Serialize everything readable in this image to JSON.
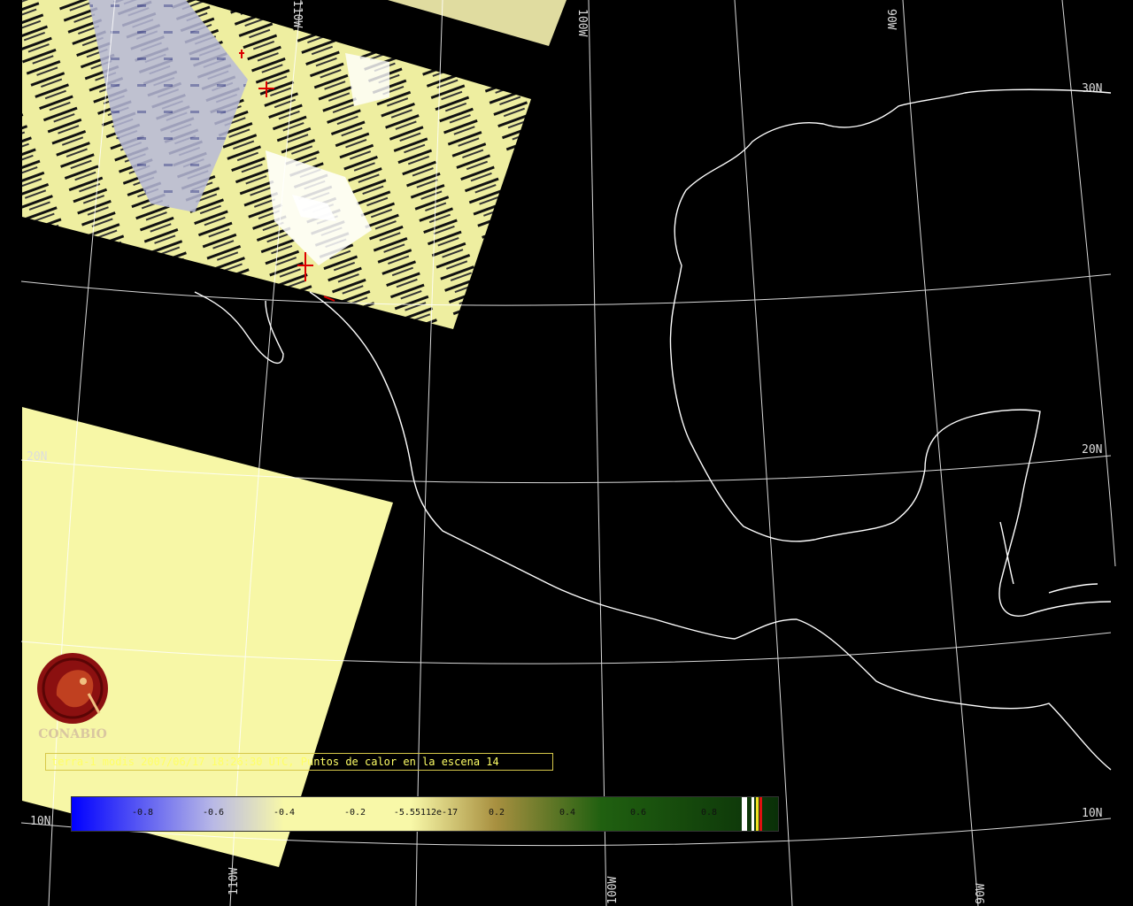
{
  "caption": "terra-1 modis 2007/06/17 18:26:30 UTC, Puntos de calor en la escena 14",
  "logo_text": "CONABIO",
  "grid_labels": {
    "top_110w": "110W",
    "top_100w": "100W",
    "top_90w": "90W",
    "bottom_110w": "110W",
    "bottom_100w": "100W",
    "bottom_90w": "90W",
    "right_30n": "30N",
    "right_20n": "20N",
    "right_10n": "10N",
    "left_20n": "20N",
    "left_10n": "10N"
  },
  "colorbar": {
    "ticks": [
      {
        "label": "-0.8",
        "value": -0.8
      },
      {
        "label": "-0.6",
        "value": -0.6
      },
      {
        "label": "-0.4",
        "value": -0.4
      },
      {
        "label": "-0.2",
        "value": -0.2
      },
      {
        "label": "-5.55112e-17",
        "value": 0.0
      },
      {
        "label": "0.2",
        "value": 0.2
      },
      {
        "label": "0.4",
        "value": 0.4
      },
      {
        "label": "0.6",
        "value": 0.6
      },
      {
        "label": "0.8",
        "value": 0.8
      }
    ],
    "min": -1.0,
    "max": 1.0,
    "colors": {
      "low": "#0000ff",
      "mid_low": "#b8b8e6",
      "mid": "#f8f8a8",
      "mid_high": "#a89040",
      "high": "#206010",
      "end": "#0a3008"
    }
  },
  "colors": {
    "background": "#000000",
    "grid": "#ffffff",
    "coast": "#ffffff",
    "scene_fill": "#f7f7a6",
    "hotspot": "#dd0000"
  }
}
